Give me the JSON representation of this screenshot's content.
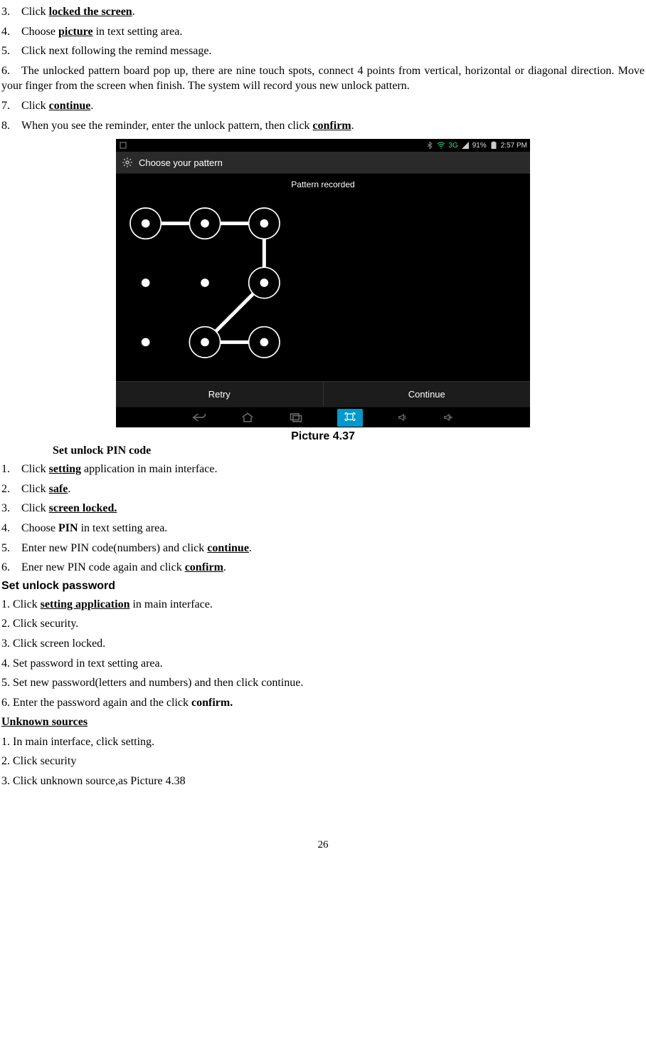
{
  "list1": {
    "n3": "3.",
    "t3_a": "Click ",
    "t3_b": "locked the screen",
    "t3_c": ".",
    "n4": "4.",
    "t4_a": "Choose ",
    "t4_b": "picture",
    "t4_c": " in text setting area.",
    "n5": "5.",
    "t5": "Click next following the remind message.",
    "n6": "6.",
    "t6": "The unlocked pattern board pop up, there are nine touch spots, connect 4 points from vertical, horizontal or diagonal direction. Move your finger from the screen when finish. The system will record yous new unlock pattern.",
    "n7": "7.",
    "t7_a": "Click ",
    "t7_b": "continue",
    "t7_c": ".",
    "n8": "8.",
    "t8_a": "When you see the reminder, enter the unlock pattern, then click ",
    "t8_b": "confirm",
    "t8_c": "."
  },
  "screenshot": {
    "status_3g": "3G",
    "status_batt": "91%",
    "status_time": "2:57 PM",
    "title": "Choose your pattern",
    "recorded": "Pattern recorded",
    "retry": "Retry",
    "continue": "Continue"
  },
  "caption": "Picture 4.37",
  "pin": {
    "heading": "Set unlock PIN code",
    "n1": "1.",
    "t1_a": "Click ",
    "t1_b": "setting",
    "t1_c": " application in main interface.",
    "n2": "2.",
    "t2_a": "Click ",
    "t2_b": "safe",
    "t2_c": ".",
    "n3": "3.",
    "t3_a": "Click ",
    "t3_b": "screen locked.",
    "n4": "4.",
    "t4_a": "Choose ",
    "t4_b": "PIN",
    "t4_c": " in text setting area.",
    "n5": "5.",
    "t5_a": "Enter new PIN code(numbers) and click ",
    "t5_b": "continue",
    "t5_c": ".",
    "n6": "6.",
    "t6_a": "Ener new PIN code again and click ",
    "t6_b": "confirm",
    "t6_c": "."
  },
  "pwd": {
    "heading": "Set unlock password",
    "l1_a": "1. Click ",
    "l1_b": "setting application",
    "l1_c": " in main interface.",
    "l2": "2. Click security.",
    "l3": "3. Click screen locked.",
    "l4": "4. Set password in text setting area.",
    "l5": "5. Set new password(letters and numbers) and then click continue.",
    "l6_a": "6. Enter the password again and the click ",
    "l6_b": "confirm."
  },
  "unknown": {
    "heading": "Unknown sources",
    "l1": "1. In main interface, click setting.",
    "l2": "2. Click security",
    "l3": "3. Click unknown source,as Picture 4.38"
  },
  "page_number": "26"
}
